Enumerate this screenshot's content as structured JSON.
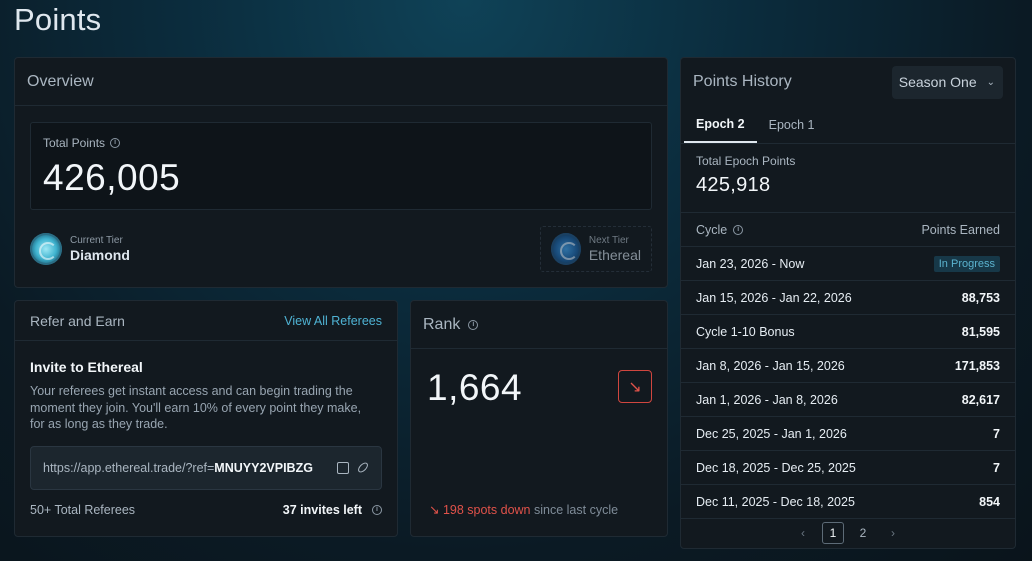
{
  "page": {
    "title": "Points"
  },
  "overview": {
    "title": "Overview",
    "total_points_label": "Total Points",
    "total_points": "426,005",
    "current_tier_label": "Current Tier",
    "current_tier": "Diamond",
    "next_tier_label": "Next Tier",
    "next_tier": "Ethereal"
  },
  "refer": {
    "title": "Refer and Earn",
    "view_all": "View All Referees",
    "invite_title": "Invite to Ethereal",
    "invite_desc": "Your referees get instant access and can begin trading the moment they join. You'll earn 10% of every point they make, for as long as they trade.",
    "link_prefix": "https://app.ethereal.trade/?ref=",
    "link_code": "MNUYY2VPIBZG",
    "total_referees": "50+ Total Referees",
    "invites_left": "37 invites left"
  },
  "rank": {
    "title": "Rank",
    "value": "1,664",
    "change": "198 spots down",
    "change_suffix": " since last cycle"
  },
  "history": {
    "title": "Points History",
    "season": "Season One",
    "tabs": [
      {
        "label": "Epoch 2",
        "active": true
      },
      {
        "label": "Epoch 1",
        "active": false
      }
    ],
    "epoch_total_label": "Total Epoch Points",
    "epoch_total": "425,918",
    "col_cycle": "Cycle",
    "col_points": "Points Earned",
    "rows": [
      {
        "cycle": "Jan 23, 2026 - Now",
        "points": "In Progress"
      },
      {
        "cycle": "Jan 15, 2026 - Jan 22, 2026",
        "points": "88,753"
      },
      {
        "cycle": "Cycle 1-10 Bonus",
        "points": "81,595"
      },
      {
        "cycle": "Jan 8, 2026 - Jan 15, 2026",
        "points": "171,853"
      },
      {
        "cycle": "Jan 1, 2026 - Jan 8, 2026",
        "points": "82,617"
      },
      {
        "cycle": "Dec 25, 2025 - Jan 1, 2026",
        "points": "7"
      },
      {
        "cycle": "Dec 18, 2025 - Dec 25, 2025",
        "points": "7"
      },
      {
        "cycle": "Dec 11, 2025 - Dec 18, 2025",
        "points": "854"
      }
    ],
    "pages": [
      "1",
      "2"
    ],
    "current_page": "1"
  }
}
